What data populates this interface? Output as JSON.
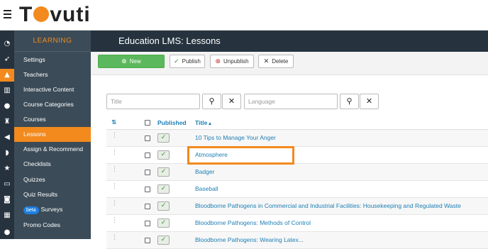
{
  "app": {
    "logo": "Tovuti",
    "logo_parts": [
      "T",
      "vuti"
    ]
  },
  "iconbar": [
    "dashboard-icon",
    "rocket-icon",
    "graduation-cap-icon",
    "chart-icon",
    "users-icon",
    "trophy-icon",
    "megaphone-icon",
    "rss-icon",
    "star-icon",
    "credit-card-icon",
    "id-badge-icon",
    "calendar-icon",
    "chat-icon"
  ],
  "sidebar": {
    "header": "LEARNING",
    "items": [
      {
        "label": "Settings"
      },
      {
        "label": "Teachers"
      },
      {
        "label": "Interactive Content"
      },
      {
        "label": "Course Categories"
      },
      {
        "label": "Courses"
      },
      {
        "label": "Lessons",
        "active": true
      },
      {
        "label": "Assign & Recommend"
      },
      {
        "label": "Checklists"
      },
      {
        "label": "Quizzes"
      },
      {
        "label": "Quiz Results"
      },
      {
        "label": "Surveys",
        "badge": "beta"
      },
      {
        "label": "Promo Codes"
      },
      {
        "label": ""
      }
    ]
  },
  "page": {
    "title": "Education LMS: Lessons"
  },
  "toolbar": {
    "new_label": "New",
    "publish_label": "Publish",
    "unpublish_label": "Unpublish",
    "delete_label": "Delete"
  },
  "filters": {
    "title_placeholder": "Title",
    "language_placeholder": "Language"
  },
  "table": {
    "headers": {
      "published": "Published",
      "title": "Title"
    },
    "rows": [
      {
        "title": "10 Tips to Manage Your Anger",
        "published": true
      },
      {
        "title": "Atmosphere",
        "published": true
      },
      {
        "title": "Badger",
        "published": true
      },
      {
        "title": "Baseball",
        "published": true
      },
      {
        "title": "Bloodborne Pathogens in Commercial and Industrial Facilities: Housekeeping and Regulated Waste",
        "published": true
      },
      {
        "title": "Bloodborne Pathogens: Methods of Control",
        "published": true
      },
      {
        "title": "Bloodborne Pathogens: Wearing Latex...",
        "published": true
      }
    ]
  },
  "colors": {
    "accent": "#f28a1e",
    "dark": "#26333f",
    "sidebar": "#3b4b57",
    "link": "#1d7fb5",
    "new_button": "#5cb85c"
  }
}
